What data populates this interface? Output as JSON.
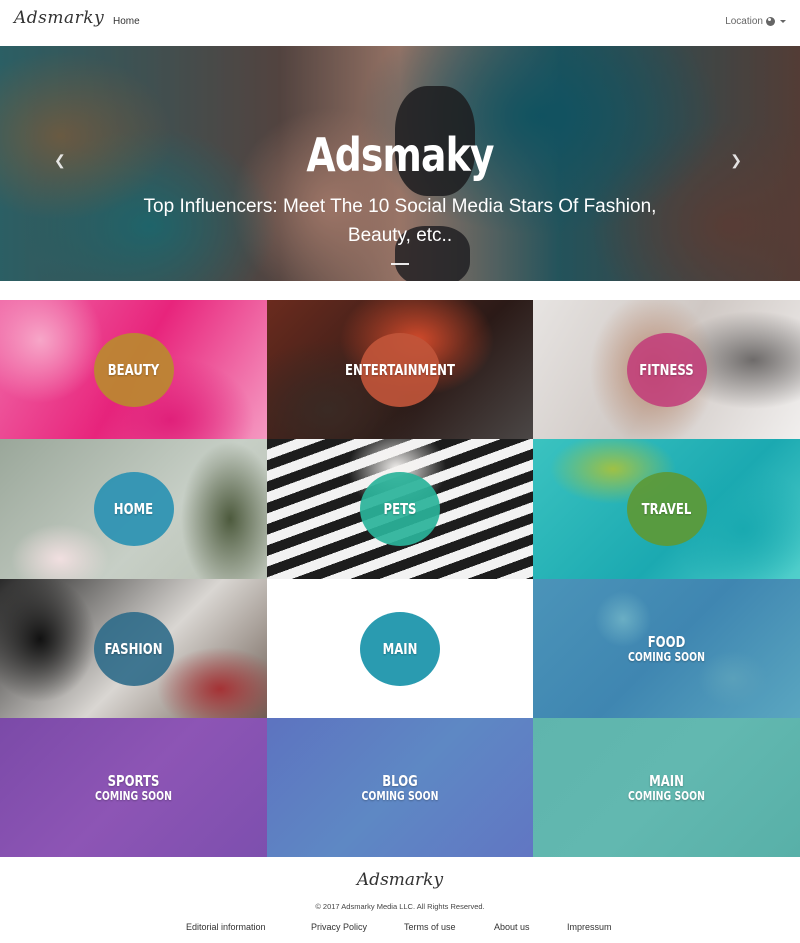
{
  "navbar": {
    "brand": "Adsmarky",
    "home_label": "Home",
    "location_label": "Location"
  },
  "hero": {
    "title": "Adsmaky",
    "subtitle": "Top Influencers: Meet The 10 Social Media Stars Of Fashion, Beauty, etc..",
    "prev_icon": "chevron-left-icon",
    "next_icon": "chevron-right-icon"
  },
  "categories": [
    {
      "label": "BEAUTY",
      "sub": ""
    },
    {
      "label": "ENTERTAINMENT",
      "sub": ""
    },
    {
      "label": "FITNESS",
      "sub": ""
    },
    {
      "label": "HOME",
      "sub": ""
    },
    {
      "label": "PETS",
      "sub": ""
    },
    {
      "label": "TRAVEL",
      "sub": ""
    },
    {
      "label": "FASHION",
      "sub": ""
    },
    {
      "label": "MAIN",
      "sub": ""
    },
    {
      "label": "FOOD",
      "sub": "COMING SOON"
    },
    {
      "label": "SPORTS",
      "sub": "COMING SOON"
    },
    {
      "label": "BLOG",
      "sub": "COMING SOON"
    },
    {
      "label": "MAIN",
      "sub": "COMING SOON"
    }
  ],
  "colors": {
    "beauty_circle": "#b98b2e",
    "entertainment_circle": "#c0553a",
    "fitness_circle": "#c23b79",
    "home_circle": "#2f93b3",
    "pets_circle": "#2ab39a",
    "travel_circle": "#5c9a3a",
    "fashion_circle": "#2f6b8a",
    "main_circle": "#2a9bb0"
  },
  "footer": {
    "brand": "Adsmarky",
    "copyright": "© 2017 Adsmarky Media LLC. All Rights Reserved.",
    "links": [
      "Editorial information",
      "Privacy Policy",
      "Terms of use",
      "About us",
      "Impressum"
    ]
  }
}
